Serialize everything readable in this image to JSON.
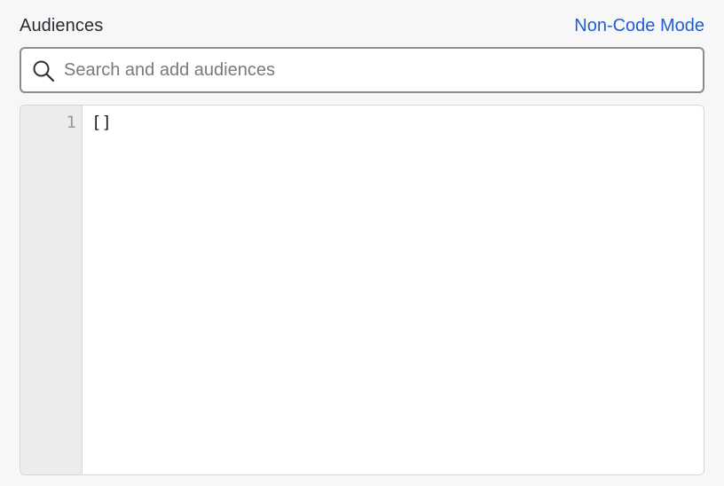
{
  "header": {
    "title": "Audiences",
    "mode_link": "Non-Code Mode"
  },
  "search": {
    "placeholder": "Search and add audiences",
    "value": "",
    "icon": "search-icon"
  },
  "editor": {
    "lines": [
      {
        "number": "1",
        "code": "[]"
      }
    ]
  }
}
